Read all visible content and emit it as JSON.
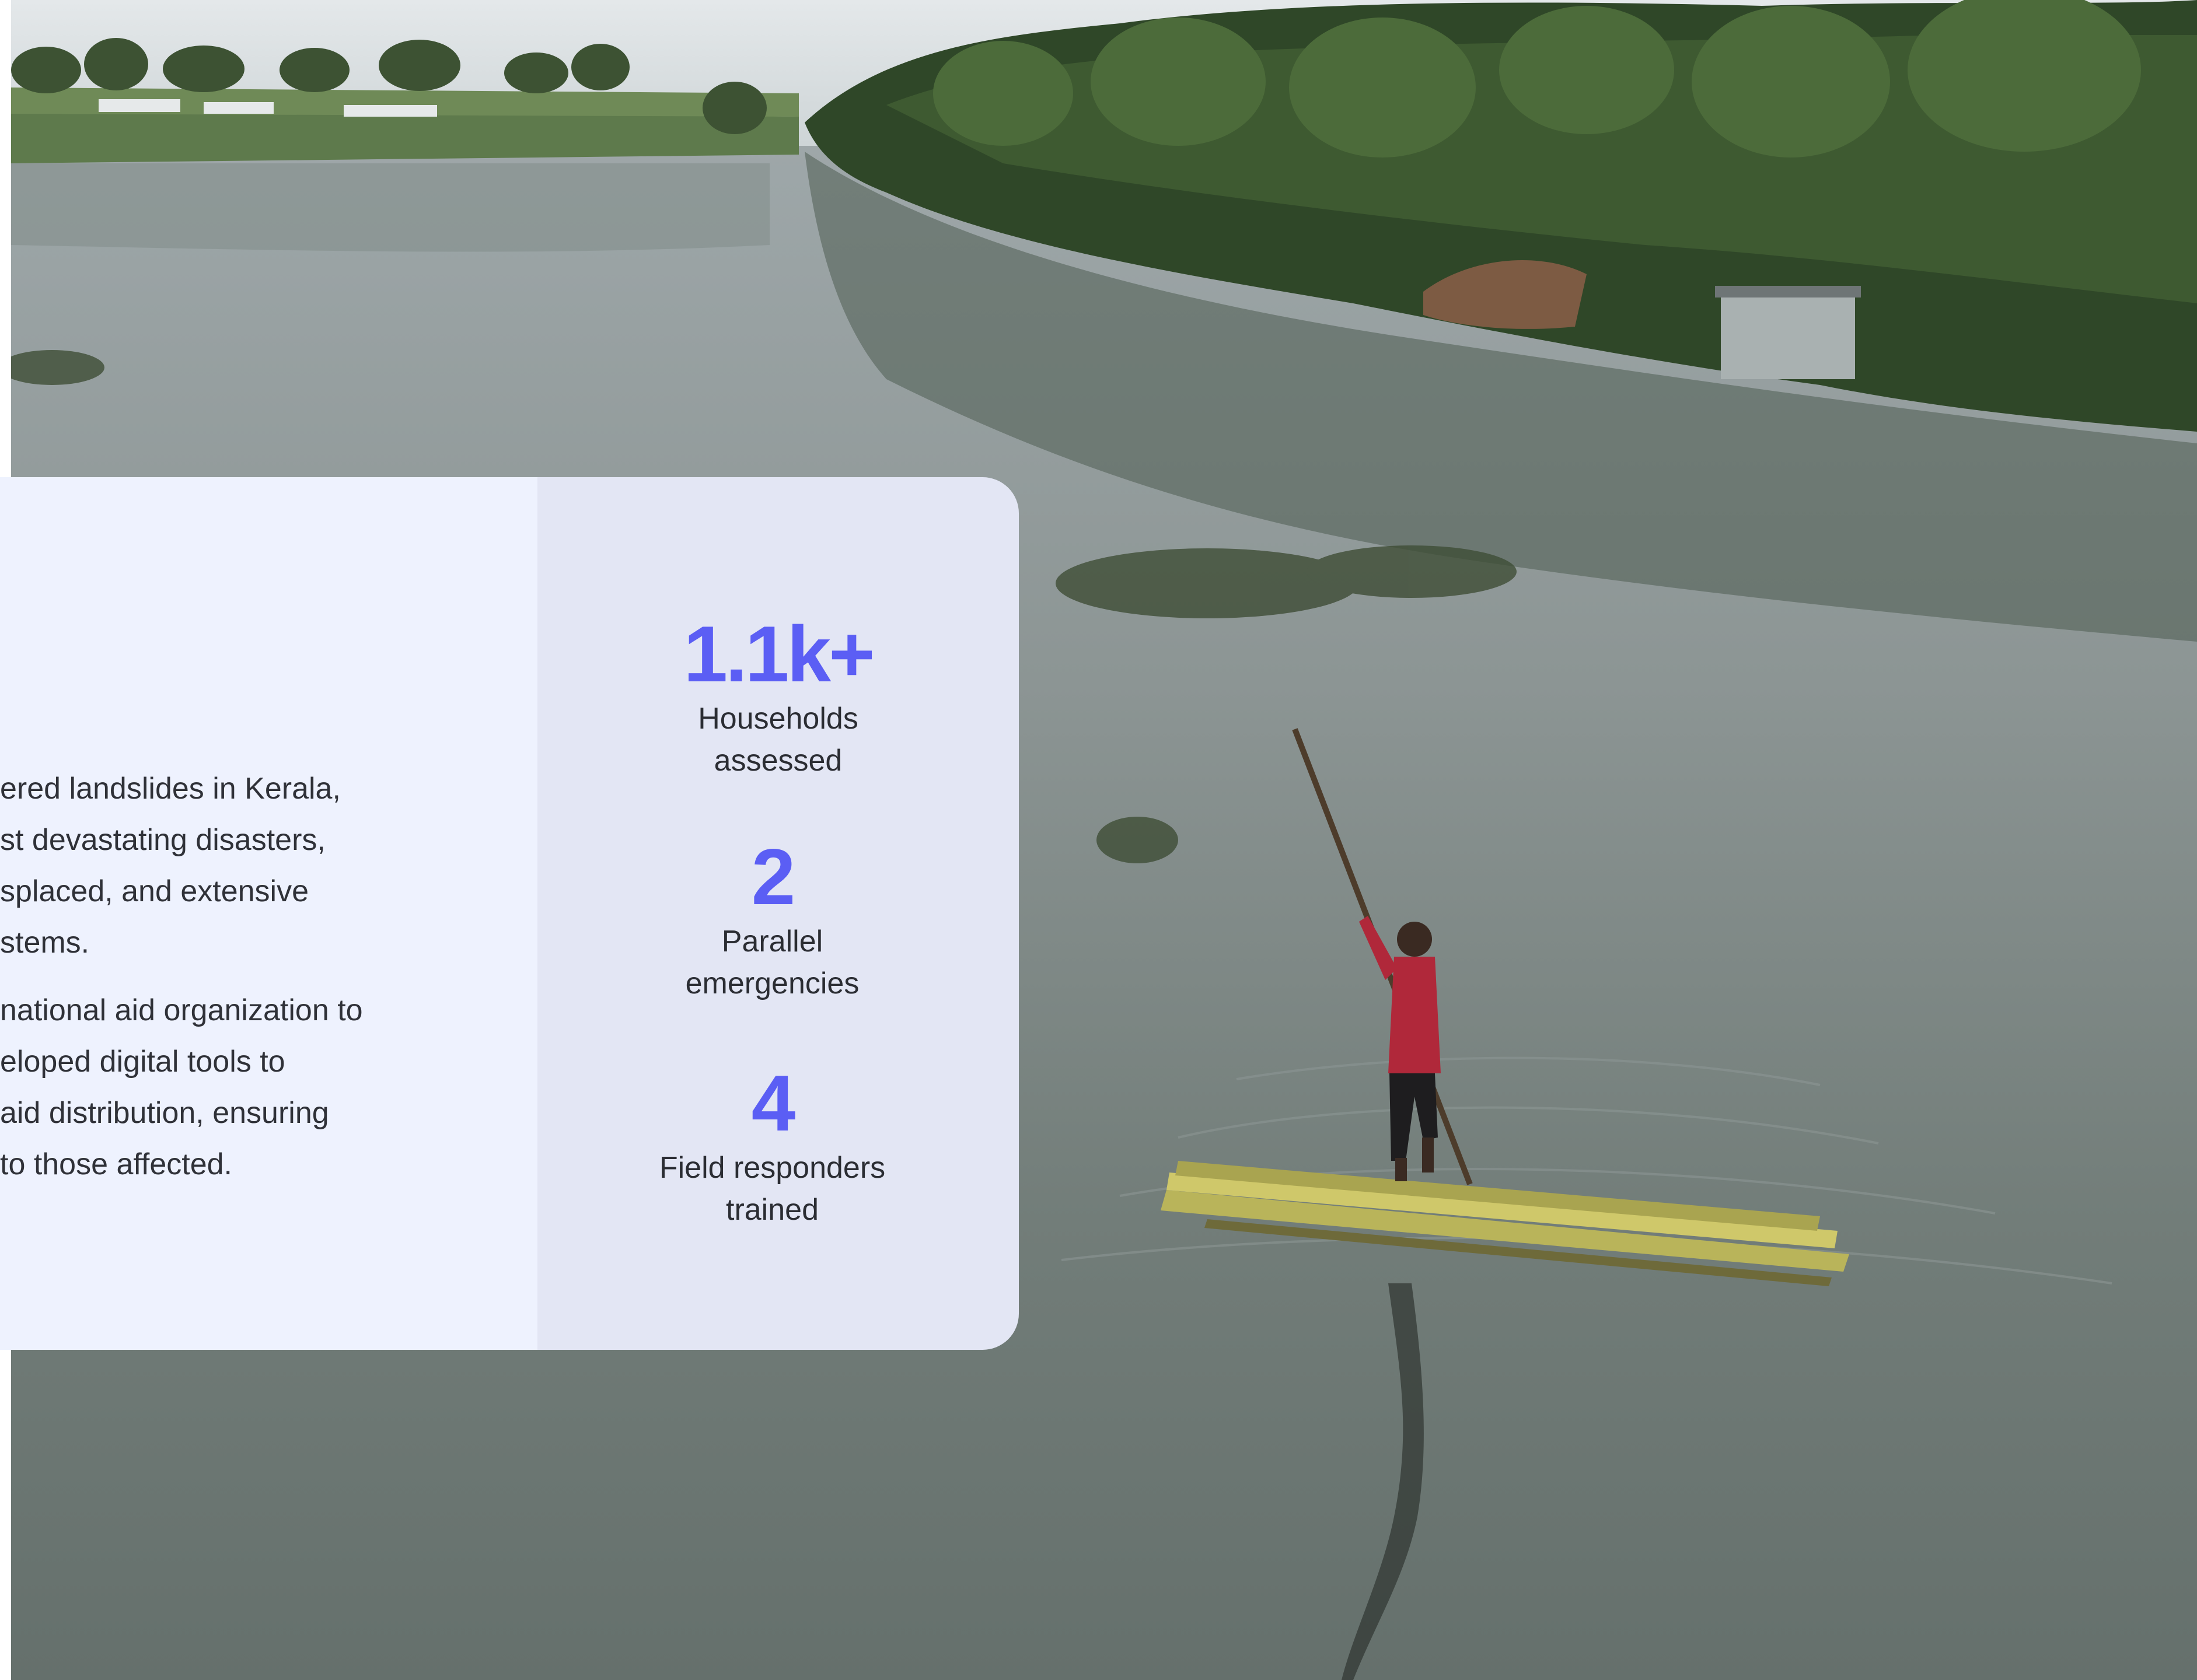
{
  "photo": {
    "description_icon": "flooded-river-photo-icon"
  },
  "intro": {
    "paragraph_1_lines": [
      "ered landslides in Kerala,",
      "st devastating disasters,",
      "splaced, and extensive",
      "stems."
    ],
    "paragraph_2_lines": [
      "national aid organization to",
      "eloped digital tools to",
      "aid distribution, ensuring",
      "to those affected."
    ]
  },
  "stats": [
    {
      "value": "1.1k+",
      "label_line_1": "Households",
      "label_line_2": "assessed"
    },
    {
      "value": "2",
      "label_line_1": "Parallel",
      "label_line_2": "emergencies"
    },
    {
      "value": "4",
      "label_line_1": "Field responders",
      "label_line_2": "trained"
    }
  ],
  "colors": {
    "accent": "#5b5ef4",
    "card_left_bg": "#eef2fe",
    "card_right_bg": "#e3e6f4",
    "body_text": "#2f3138"
  }
}
